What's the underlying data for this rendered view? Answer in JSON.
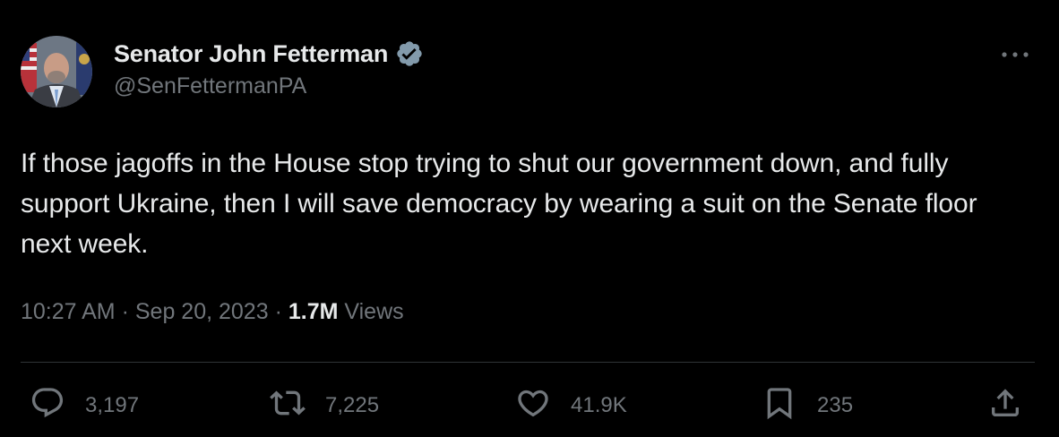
{
  "author": {
    "display_name": "Senator John Fetterman",
    "handle": "@SenFettermanPA",
    "verified_icon": "verified-badge-icon",
    "verified_color": "#829aab"
  },
  "tweet": {
    "text": "If those jagoffs in the House stop trying to shut our government down, and fully support Ukraine, then I will save democracy by wearing a suit on the Senate floor next week.",
    "time": "10:27 AM",
    "date": "Sep 20, 2023",
    "views_count": "1.7M",
    "views_label": "Views",
    "separator": "·"
  },
  "actions": {
    "reply": {
      "icon": "reply-icon",
      "count": "3,197"
    },
    "retweet": {
      "icon": "retweet-icon",
      "count": "7,225"
    },
    "like": {
      "icon": "heart-icon",
      "count": "41.9K"
    },
    "bookmark": {
      "icon": "bookmark-icon",
      "count": "235"
    },
    "share": {
      "icon": "share-icon"
    }
  },
  "colors": {
    "background": "#000000",
    "primary_text": "#e7e9ea",
    "secondary_text": "#71767b",
    "divider": "#2f3336"
  }
}
